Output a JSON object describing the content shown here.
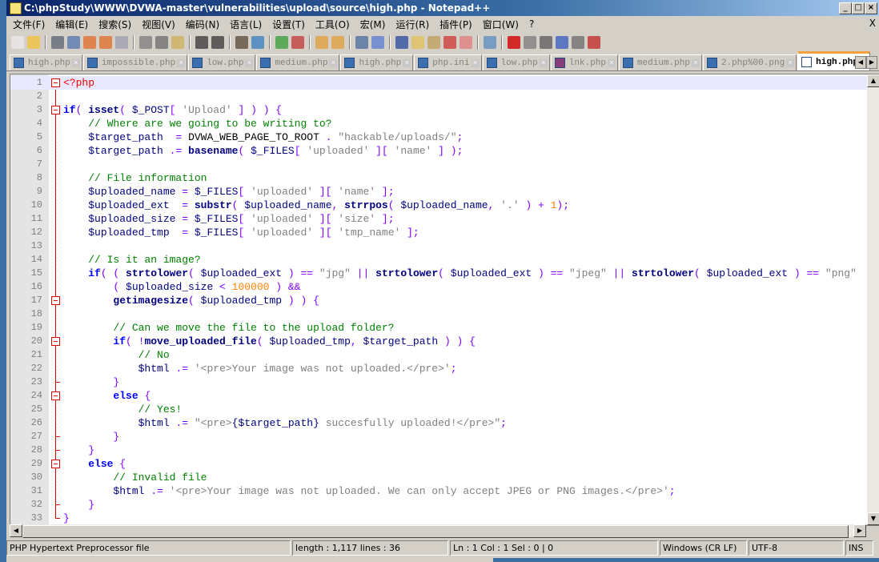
{
  "window": {
    "title": "C:\\phpStudy\\WWW\\DVWA-master\\vulnerabilities\\upload\\source\\high.php - Notepad++"
  },
  "menu": [
    "文件(F)",
    "编辑(E)",
    "搜索(S)",
    "视图(V)",
    "编码(N)",
    "语言(L)",
    "设置(T)",
    "工具(O)",
    "宏(M)",
    "运行(R)",
    "插件(P)",
    "窗口(W)",
    "?"
  ],
  "menu_close": "X",
  "toolbar": [
    "new",
    "open",
    "save",
    "save-all",
    "close",
    "close-all",
    "print",
    "cut",
    "copy",
    "paste",
    "undo",
    "redo",
    "find",
    "replace",
    "zoom-in",
    "zoom-out",
    "sync-v",
    "sync-h",
    "wrap",
    "show-all",
    "indent-guide",
    "udl",
    "doc-map",
    "function-list",
    "folder",
    "monitor",
    "record",
    "stop",
    "play",
    "run-multiple",
    "save-macro",
    "spell-check"
  ],
  "tabs": [
    {
      "label": "high.php",
      "icon_color": "#3c6fb0"
    },
    {
      "label": "impossible.php",
      "icon_color": "#3c6fb0"
    },
    {
      "label": "low.php",
      "icon_color": "#3c6fb0"
    },
    {
      "label": "medium.php",
      "icon_color": "#3c6fb0"
    },
    {
      "label": "high.php",
      "icon_color": "#3c6fb0"
    },
    {
      "label": "php.ini",
      "icon_color": "#3c6fb0"
    },
    {
      "label": "low.php",
      "icon_color": "#3c6fb0"
    },
    {
      "label": "lnk.php",
      "icon_color": "#8a3c78"
    },
    {
      "label": "medium.php",
      "icon_color": "#3c6fb0"
    },
    {
      "label": "2.php%00.png",
      "icon_color": "#3c6fb0"
    },
    {
      "label": "high.php",
      "icon_color": "#ffffff",
      "active": true
    }
  ],
  "code": [
    [
      [
        "tag",
        "<?php"
      ]
    ],
    [],
    [
      [
        "kw",
        "if"
      ],
      [
        "op",
        "( "
      ],
      [
        "fn",
        "isset"
      ],
      [
        "op",
        "( "
      ],
      [
        "var",
        "$_POST"
      ],
      [
        "op",
        "[ "
      ],
      [
        "str",
        "'Upload'"
      ],
      [
        "op",
        " ] ) ) {"
      ]
    ],
    [
      [
        "pl",
        "    "
      ],
      [
        "cm",
        "// Where are we going to be writing to?"
      ]
    ],
    [
      [
        "pl",
        "    "
      ],
      [
        "var",
        "$target_path"
      ],
      [
        "op",
        "  = "
      ],
      [
        "pl",
        "DVWA_WEB_PAGE_TO_ROOT "
      ],
      [
        "op",
        ". "
      ],
      [
        "str",
        "\"hackable/uploads/\""
      ],
      [
        "op",
        ";"
      ]
    ],
    [
      [
        "pl",
        "    "
      ],
      [
        "var",
        "$target_path"
      ],
      [
        "op",
        " .= "
      ],
      [
        "fn",
        "basename"
      ],
      [
        "op",
        "( "
      ],
      [
        "var",
        "$_FILES"
      ],
      [
        "op",
        "[ "
      ],
      [
        "str",
        "'uploaded'"
      ],
      [
        "op",
        " ][ "
      ],
      [
        "str",
        "'name'"
      ],
      [
        "op",
        " ] );"
      ]
    ],
    [],
    [
      [
        "pl",
        "    "
      ],
      [
        "cm",
        "// File information"
      ]
    ],
    [
      [
        "pl",
        "    "
      ],
      [
        "var",
        "$uploaded_name"
      ],
      [
        "op",
        " = "
      ],
      [
        "var",
        "$_FILES"
      ],
      [
        "op",
        "[ "
      ],
      [
        "str",
        "'uploaded'"
      ],
      [
        "op",
        " ][ "
      ],
      [
        "str",
        "'name'"
      ],
      [
        "op",
        " ];"
      ]
    ],
    [
      [
        "pl",
        "    "
      ],
      [
        "var",
        "$uploaded_ext"
      ],
      [
        "op",
        "  = "
      ],
      [
        "fn",
        "substr"
      ],
      [
        "op",
        "( "
      ],
      [
        "var",
        "$uploaded_name"
      ],
      [
        "op",
        ", "
      ],
      [
        "fn",
        "strrpos"
      ],
      [
        "op",
        "( "
      ],
      [
        "var",
        "$uploaded_name"
      ],
      [
        "op",
        ", "
      ],
      [
        "str",
        "'.'"
      ],
      [
        "op",
        " ) + "
      ],
      [
        "num",
        "1"
      ],
      [
        "op",
        ");"
      ]
    ],
    [
      [
        "pl",
        "    "
      ],
      [
        "var",
        "$uploaded_size"
      ],
      [
        "op",
        " = "
      ],
      [
        "var",
        "$_FILES"
      ],
      [
        "op",
        "[ "
      ],
      [
        "str",
        "'uploaded'"
      ],
      [
        "op",
        " ][ "
      ],
      [
        "str",
        "'size'"
      ],
      [
        "op",
        " ];"
      ]
    ],
    [
      [
        "pl",
        "    "
      ],
      [
        "var",
        "$uploaded_tmp"
      ],
      [
        "op",
        "  = "
      ],
      [
        "var",
        "$_FILES"
      ],
      [
        "op",
        "[ "
      ],
      [
        "str",
        "'uploaded'"
      ],
      [
        "op",
        " ][ "
      ],
      [
        "str",
        "'tmp_name'"
      ],
      [
        "op",
        " ];"
      ]
    ],
    [],
    [
      [
        "pl",
        "    "
      ],
      [
        "cm",
        "// Is it an image?"
      ]
    ],
    [
      [
        "pl",
        "    "
      ],
      [
        "kw",
        "if"
      ],
      [
        "op",
        "( ( "
      ],
      [
        "fn",
        "strtolower"
      ],
      [
        "op",
        "( "
      ],
      [
        "var",
        "$uploaded_ext"
      ],
      [
        "op",
        " ) == "
      ],
      [
        "str",
        "\"jpg\""
      ],
      [
        "op",
        " || "
      ],
      [
        "fn",
        "strtolower"
      ],
      [
        "op",
        "( "
      ],
      [
        "var",
        "$uploaded_ext"
      ],
      [
        "op",
        " ) == "
      ],
      [
        "str",
        "\"jpeg\""
      ],
      [
        "op",
        " || "
      ],
      [
        "fn",
        "strtolower"
      ],
      [
        "op",
        "( "
      ],
      [
        "var",
        "$uploaded_ext"
      ],
      [
        "op",
        " ) == "
      ],
      [
        "str",
        "\"png\""
      ]
    ],
    [
      [
        "pl",
        "        "
      ],
      [
        "op",
        "( "
      ],
      [
        "var",
        "$uploaded_size"
      ],
      [
        "op",
        " < "
      ],
      [
        "num",
        "100000"
      ],
      [
        "op",
        " ) &&"
      ]
    ],
    [
      [
        "pl",
        "        "
      ],
      [
        "fn",
        "getimagesize"
      ],
      [
        "op",
        "( "
      ],
      [
        "var",
        "$uploaded_tmp"
      ],
      [
        "op",
        " ) ) {"
      ]
    ],
    [],
    [
      [
        "pl",
        "        "
      ],
      [
        "cm",
        "// Can we move the file to the upload folder?"
      ]
    ],
    [
      [
        "pl",
        "        "
      ],
      [
        "kw",
        "if"
      ],
      [
        "op",
        "( !"
      ],
      [
        "fn",
        "move_uploaded_file"
      ],
      [
        "op",
        "( "
      ],
      [
        "var",
        "$uploaded_tmp"
      ],
      [
        "op",
        ", "
      ],
      [
        "var",
        "$target_path"
      ],
      [
        "op",
        " ) ) {"
      ]
    ],
    [
      [
        "pl",
        "            "
      ],
      [
        "cm",
        "// No"
      ]
    ],
    [
      [
        "pl",
        "            "
      ],
      [
        "var",
        "$html"
      ],
      [
        "op",
        " .= "
      ],
      [
        "str",
        "'<pre>Your image was not uploaded.</pre>'"
      ],
      [
        "op",
        ";"
      ]
    ],
    [
      [
        "pl",
        "        "
      ],
      [
        "op",
        "}"
      ]
    ],
    [
      [
        "pl",
        "        "
      ],
      [
        "kw",
        "else"
      ],
      [
        "op",
        " {"
      ]
    ],
    [
      [
        "pl",
        "            "
      ],
      [
        "cm",
        "// Yes!"
      ]
    ],
    [
      [
        "pl",
        "            "
      ],
      [
        "var",
        "$html"
      ],
      [
        "op",
        " .= "
      ],
      [
        "str",
        "\"<pre>"
      ],
      [
        "var",
        "{$target_path}"
      ],
      [
        "str",
        " succesfully uploaded!</pre>\""
      ],
      [
        "op",
        ";"
      ]
    ],
    [
      [
        "pl",
        "        "
      ],
      [
        "op",
        "}"
      ]
    ],
    [
      [
        "pl",
        "    "
      ],
      [
        "op",
        "}"
      ]
    ],
    [
      [
        "pl",
        "    "
      ],
      [
        "kw",
        "else"
      ],
      [
        "op",
        " {"
      ]
    ],
    [
      [
        "pl",
        "        "
      ],
      [
        "cm",
        "// Invalid file"
      ]
    ],
    [
      [
        "pl",
        "        "
      ],
      [
        "var",
        "$html"
      ],
      [
        "op",
        " .= "
      ],
      [
        "str",
        "'<pre>Your image was not uploaded. We can only accept JPEG or PNG images.</pre>'"
      ],
      [
        "op",
        ";"
      ]
    ],
    [
      [
        "pl",
        "    "
      ],
      [
        "op",
        "}"
      ]
    ],
    [
      [
        "op",
        "}"
      ]
    ]
  ],
  "fold_open": [
    1,
    3,
    17,
    20,
    24,
    29
  ],
  "fold_end": [
    23,
    27,
    28,
    32,
    33
  ],
  "current_line": 1,
  "status": {
    "file_type": "PHP Hypertext Preprocessor file",
    "length": "length : 1,117   lines : 36",
    "position": "Ln : 1   Col : 1   Sel : 0 | 0",
    "eol": "Windows (CR LF)",
    "encoding": "UTF-8",
    "mode": "INS"
  }
}
